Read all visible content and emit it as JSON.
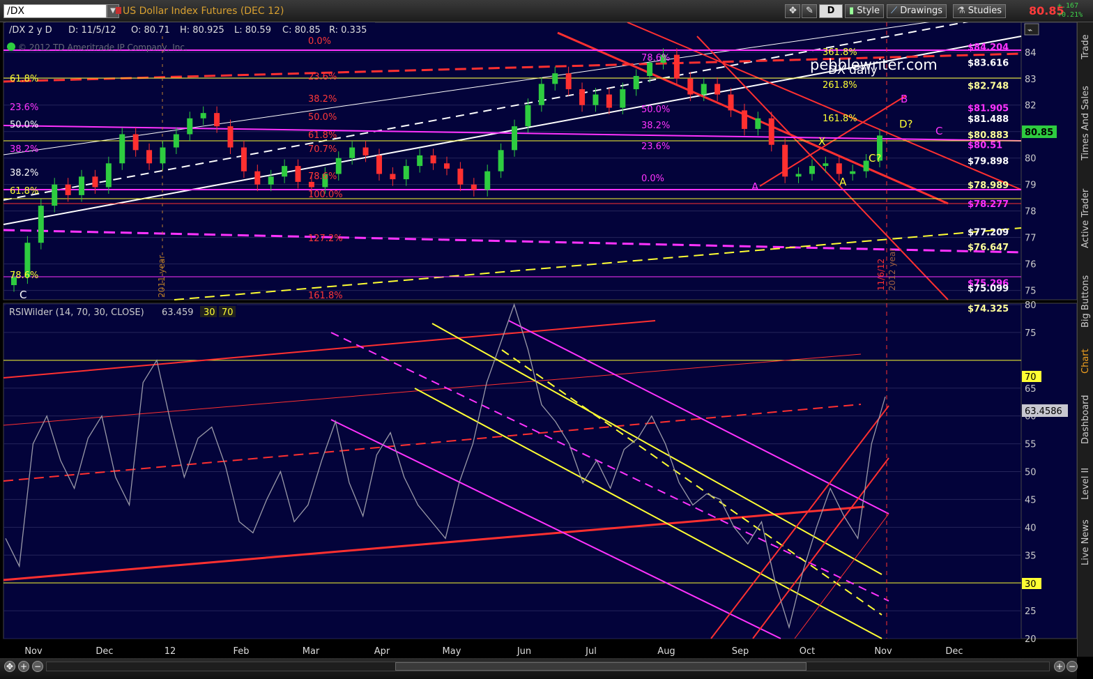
{
  "toolbar": {
    "symbol": "/DX",
    "instrument_title": "US Dollar Index Futures (DEC 12)",
    "aggregation_label": "D",
    "style_label": "Style",
    "drawings_label": "Drawings",
    "studies_label": "Studies",
    "last_price": "80.85",
    "change_abs": "+.167",
    "change_pct": "+0.21%"
  },
  "colors": {
    "background": "#000033",
    "panel_bg": "#03033a",
    "up_candle": "#2ecc40",
    "down_candle": "#ff3030",
    "fib_red": "#ff3838",
    "fib_magenta": "#ff33ff",
    "fib_yellow": "#ffff33",
    "rsi_line": "#9a9aa8"
  },
  "side_tabs": [
    "Trade",
    "Times And Sales",
    "Active Trader",
    "Big Buttons",
    "Chart",
    "Dashboard",
    "Level II",
    "Live News"
  ],
  "chart_data": [
    {
      "type": "candlestick",
      "header": {
        "symbol_period": "/DX 2 y D",
        "date": "D: 11/5/12",
        "open": "O: 80.71",
        "high": "H: 80.925",
        "low": "L: 80.59",
        "close": "C: 80.85",
        "range": "R: 0.335"
      },
      "copyright": "© 2012 TD Ameritrade IP Company, Inc.",
      "watermark": "pebblewriter.com",
      "subtitle": "DX daily",
      "ylim": [
        74.7,
        84.6
      ],
      "y_ticks": [
        75,
        76,
        77,
        78,
        79,
        80,
        81,
        82,
        83,
        84
      ],
      "last_price_tag": "80.85",
      "x_months": [
        "Nov",
        "Dec",
        "12",
        "Feb",
        "Mar",
        "Apr",
        "May",
        "Jun",
        "Jul",
        "Aug",
        "Sep",
        "Oct",
        "Nov",
        "Dec"
      ],
      "closes": [
        75.5,
        76.8,
        78.2,
        79.0,
        78.6,
        79.3,
        78.9,
        79.8,
        80.9,
        80.3,
        79.8,
        80.4,
        80.9,
        81.5,
        81.7,
        81.2,
        80.4,
        79.5,
        79.0,
        79.3,
        79.7,
        79.1,
        78.9,
        79.4,
        80.0,
        80.4,
        80.1,
        79.4,
        79.2,
        79.7,
        80.1,
        79.8,
        79.6,
        79.0,
        78.8,
        79.5,
        80.3,
        81.2,
        82.0,
        82.8,
        83.2,
        82.6,
        82.0,
        82.4,
        81.9,
        82.6,
        83.1,
        83.6,
        83.9,
        83.0,
        82.4,
        82.8,
        82.4,
        81.8,
        81.1,
        81.5,
        80.5,
        79.3,
        79.4,
        79.7,
        79.8,
        79.4,
        79.5,
        79.9,
        80.85
      ],
      "price_labels_right": [
        "$84.204",
        "$83.616",
        "$82.748",
        "$81.905",
        "$81.488",
        "$80.883",
        "$80.51",
        "$79.898",
        "$78.989",
        "$78.277",
        "$77.209",
        "$76.647",
        "$75.296",
        "$75.099",
        "$74.325"
      ],
      "fib_labels": [
        "0.0%",
        "23.6%",
        "38.2%",
        "50.0%",
        "61.8%",
        "70.7%",
        "78.6%",
        "100.0%",
        "127.2%",
        "161.8%",
        "261.8%",
        "361.8%"
      ],
      "wave_labels": [
        "A",
        "B",
        "C",
        "X",
        "D?",
        "C?",
        "C",
        "B"
      ],
      "vertical_markers": [
        "2011 year",
        "11/6/12",
        "2012 year"
      ]
    },
    {
      "type": "line",
      "study_label": "RSIWilder (14, 70, 30, CLOSE)",
      "current_value": "63.459",
      "overbought": "70",
      "oversold": "30",
      "scale_value": "63.4586",
      "ylim": [
        20,
        80
      ],
      "y_ticks": [
        20,
        25,
        30,
        35,
        40,
        45,
        50,
        55,
        60,
        65,
        70,
        75,
        80
      ],
      "levels": [
        30,
        70
      ],
      "values": [
        38,
        33,
        55,
        60,
        52,
        47,
        56,
        60,
        49,
        44,
        66,
        70,
        59,
        49,
        56,
        58,
        51,
        41,
        39,
        45,
        50,
        41,
        44,
        52,
        59,
        48,
        42,
        53,
        57,
        49,
        44,
        41,
        38,
        48,
        55,
        66,
        73,
        80,
        72,
        62,
        59,
        55,
        48,
        52,
        47,
        54,
        56,
        60,
        55,
        48,
        44,
        46,
        45,
        40,
        37,
        41,
        30,
        22,
        32,
        40,
        47,
        42,
        38,
        55,
        63.46
      ]
    }
  ]
}
